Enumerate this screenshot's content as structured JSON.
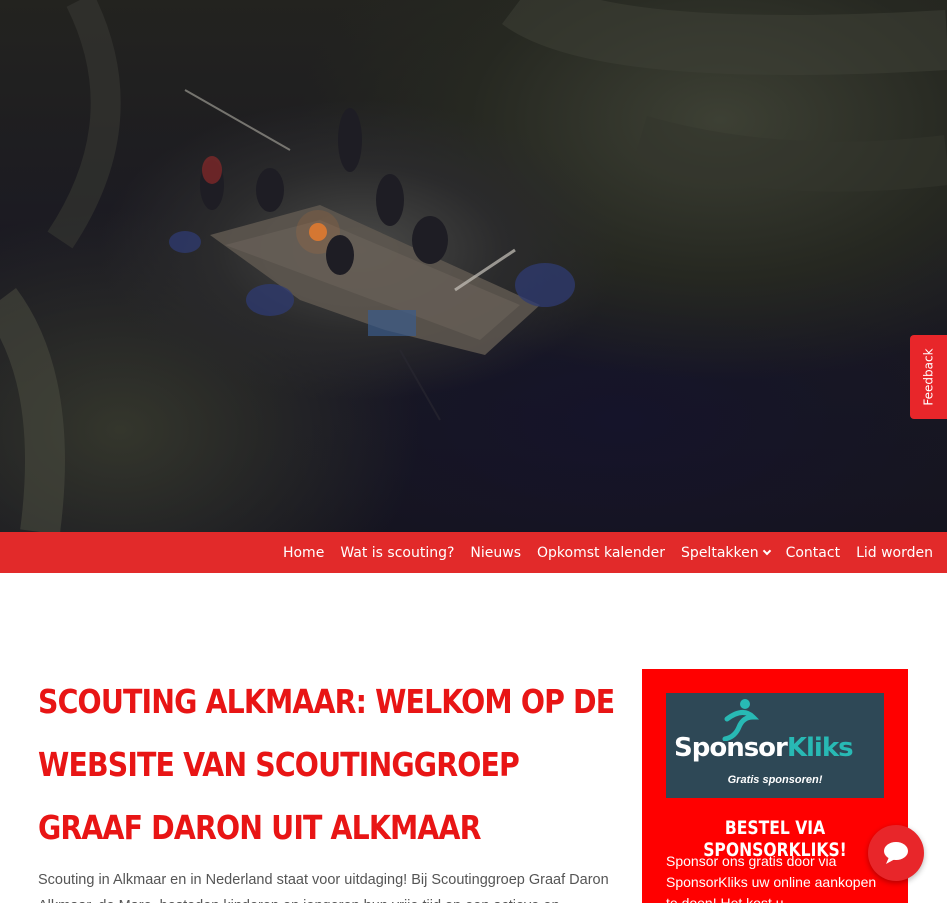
{
  "hero": {
    "image": "scouts-raft-at-dusk"
  },
  "feedback": {
    "label": "Feedback"
  },
  "nav": {
    "items": [
      {
        "label": "Home"
      },
      {
        "label": "Wat is scouting?"
      },
      {
        "label": "Nieuws"
      },
      {
        "label": "Opkomst kalender"
      },
      {
        "label": "Speltakken",
        "has_dropdown": true
      },
      {
        "label": "Contact"
      },
      {
        "label": "Lid worden"
      }
    ]
  },
  "main": {
    "title": "Scouting Alkmaar: welkom op de website van Scoutinggroep Graaf Daron uit Alkmaar",
    "intro": "Scouting in Alkmaar en in Nederland staat voor uitdaging! Bij Scoutinggroep Graaf Daron Alkmaar, de Mare, besteden kinderen en jongeren hun vrije tijd op een actieve en"
  },
  "sidebar": {
    "logo": {
      "brand_part1": "Sponsor",
      "brand_part2": "Kliks",
      "tagline": "Gratis sponsoren!"
    },
    "widget_title": "Bestel via SponsorKliks!",
    "widget_text": "Sponsor ons gratis door via SponsorKliks uw online aankopen te doen! Het kost u"
  },
  "chat": {
    "icon": "chat-bubble-icon"
  },
  "colors": {
    "brand_red": "#e22a2a",
    "title_red": "#e81515",
    "sidebar_red": "#ff0000",
    "sponsor_teal": "#28b9b4",
    "sponsor_bg": "#2e4856"
  }
}
